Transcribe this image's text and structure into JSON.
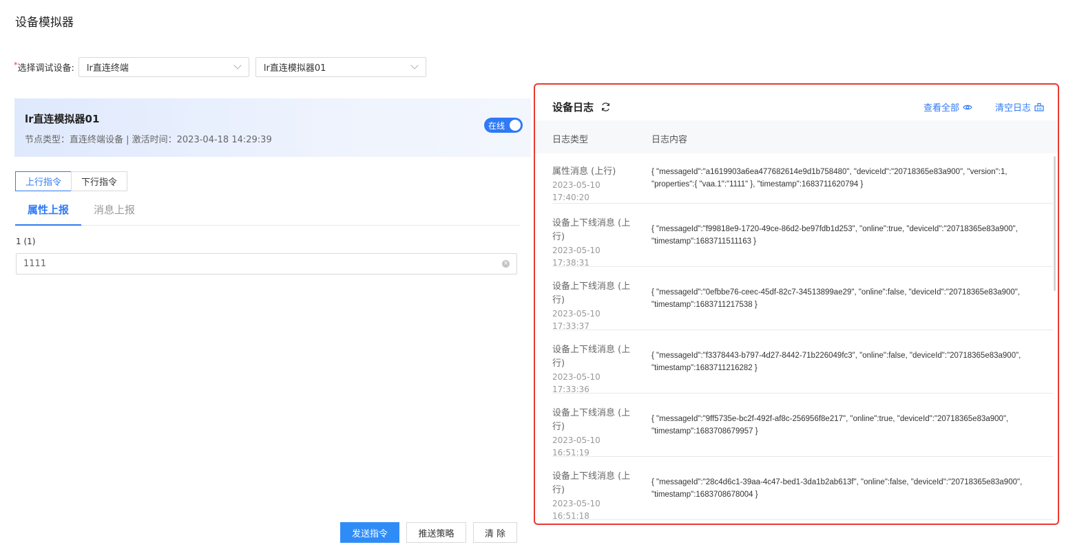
{
  "page": {
    "title": "设备模拟器"
  },
  "device_select": {
    "label": "选择调试设备:",
    "required_mark": "*",
    "product_value": "lr直连终端",
    "device_value": "lr直连模拟器01"
  },
  "device_card": {
    "name": "lr直连模拟器01",
    "meta": "节点类型：直连终端设备 | 激活时间：2023-04-18 14:29:39",
    "status_label": "在线",
    "status_on": true
  },
  "command_tabs": [
    {
      "label": "上行指令",
      "active": true
    },
    {
      "label": "下行指令",
      "active": false
    }
  ],
  "report_tabs": [
    {
      "label": "属性上报",
      "active": true
    },
    {
      "label": "消息上报",
      "active": false
    }
  ],
  "property_field": {
    "label": "1 (1)",
    "value": "1111"
  },
  "actions": {
    "send": "发送指令",
    "push_strategy": "推送策略",
    "clear": "清 除"
  },
  "log_panel": {
    "title": "设备日志",
    "view_all": "查看全部",
    "clear_log": "清空日志",
    "col_type": "日志类型",
    "col_content": "日志内容",
    "rows": [
      {
        "type": "属性消息 (上行)",
        "time": "2023-05-10 17:40:20",
        "content": "{ \"messageId\":\"a1619903a6ea477682614e9d1b758480\", \"deviceId\":\"20718365e83a900\", \"version\":1, \"properties\":{ \"vaa.1\":\"1111\" }, \"timestamp\":1683711620794 }"
      },
      {
        "type": "设备上下线消息 (上行)",
        "time": "2023-05-10 17:38:31",
        "content": "{ \"messageId\":\"f99818e9-1720-49ce-86d2-be97fdb1d253\", \"online\":true, \"deviceId\":\"20718365e83a900\", \"timestamp\":1683711511163 }"
      },
      {
        "type": "设备上下线消息 (上行)",
        "time": "2023-05-10 17:33:37",
        "content": "{ \"messageId\":\"0efbbe76-ceec-45df-82c7-34513899ae29\", \"online\":false, \"deviceId\":\"20718365e83a900\", \"timestamp\":1683711217538 }"
      },
      {
        "type": "设备上下线消息 (上行)",
        "time": "2023-05-10 17:33:36",
        "content": "{ \"messageId\":\"f3378443-b797-4d27-8442-71b226049fc3\", \"online\":false, \"deviceId\":\"20718365e83a900\", \"timestamp\":1683711216282 }"
      },
      {
        "type": "设备上下线消息 (上行)",
        "time": "2023-05-10 16:51:19",
        "content": "{ \"messageId\":\"9ff5735e-bc2f-492f-af8c-256956f8e217\", \"online\":true, \"deviceId\":\"20718365e83a900\", \"timestamp\":1683708679957 }"
      },
      {
        "type": "设备上下线消息 (上行)",
        "time": "2023-05-10 16:51:18",
        "content": "{ \"messageId\":\"28c4d6c1-39aa-4c47-bed1-3da1b2ab613f\", \"online\":false, \"deviceId\":\"20718365e83a900\", \"timestamp\":1683708678004 }"
      }
    ]
  },
  "colors": {
    "primary": "#2f7af5",
    "highlight_border": "#e8382f",
    "card_bg": "#dfe9fd"
  }
}
